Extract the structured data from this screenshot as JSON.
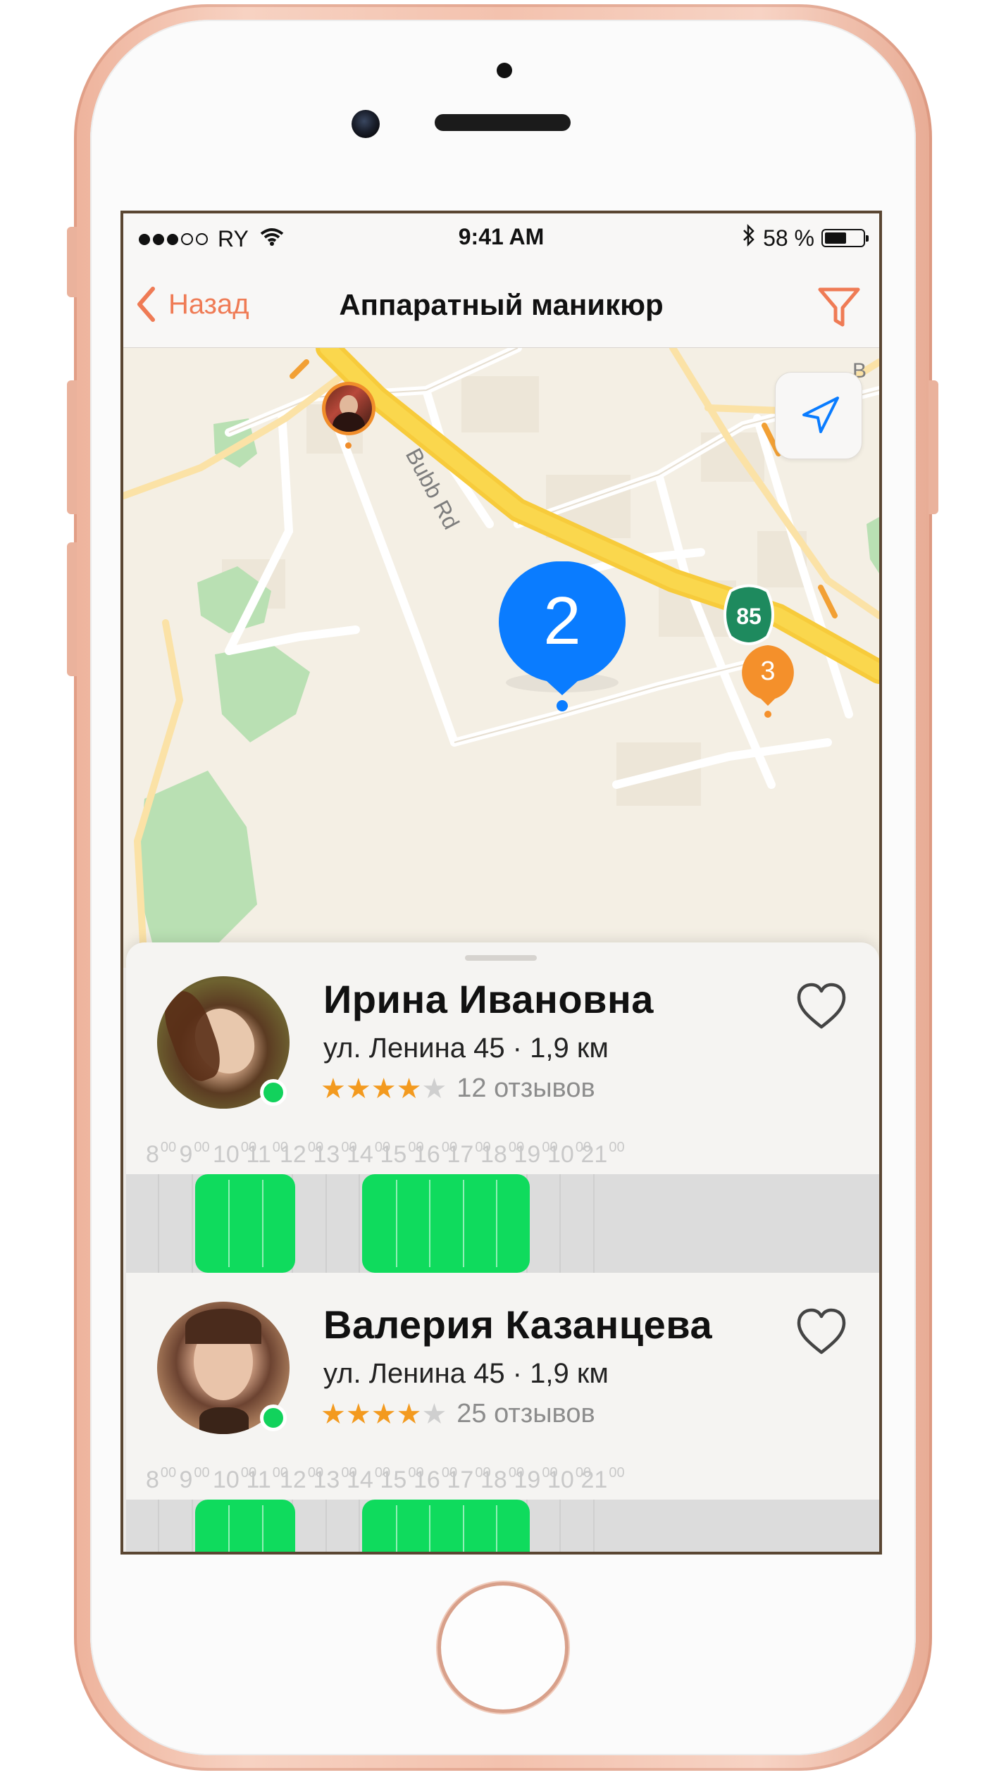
{
  "status_bar": {
    "carrier": "RY",
    "time": "9:41 AM",
    "battery": "58 %",
    "battery_level": 0.58
  },
  "nav": {
    "back_label": "Назад",
    "title": "Аппаратный маникюр"
  },
  "map": {
    "road_label": "Bubb Rd",
    "highway_shield": "85",
    "cluster_blue_count": "2",
    "cluster_orange_count": "3"
  },
  "hours": [
    "8",
    "9",
    "10",
    "11",
    "12",
    "13",
    "14",
    "15",
    "16",
    "17",
    "18",
    "19",
    "10",
    "21"
  ],
  "hours_suffix": "00",
  "masters": [
    {
      "name": "Ирина Ивановна",
      "address": "ул. Ленина 45 · 1,9 км",
      "rating": 4,
      "reviews": "12 отзывов",
      "online": true,
      "slots": [
        [
          "9",
          "12"
        ],
        [
          "14",
          "19"
        ]
      ]
    },
    {
      "name": "Валерия Казанцева",
      "address": "ул. Ленина 45 · 1,9 км",
      "rating": 4,
      "reviews": "25 отзывов",
      "online": true,
      "slots": [
        [
          "9",
          "12"
        ],
        [
          "14",
          "19"
        ]
      ]
    }
  ],
  "colors": {
    "accent": "#ef7b55",
    "available": "#0fdb5d",
    "online": "#12d25c",
    "cluster_blue": "#0a7cff",
    "cluster_orange": "#f4902b",
    "star": "#f39a1f"
  }
}
